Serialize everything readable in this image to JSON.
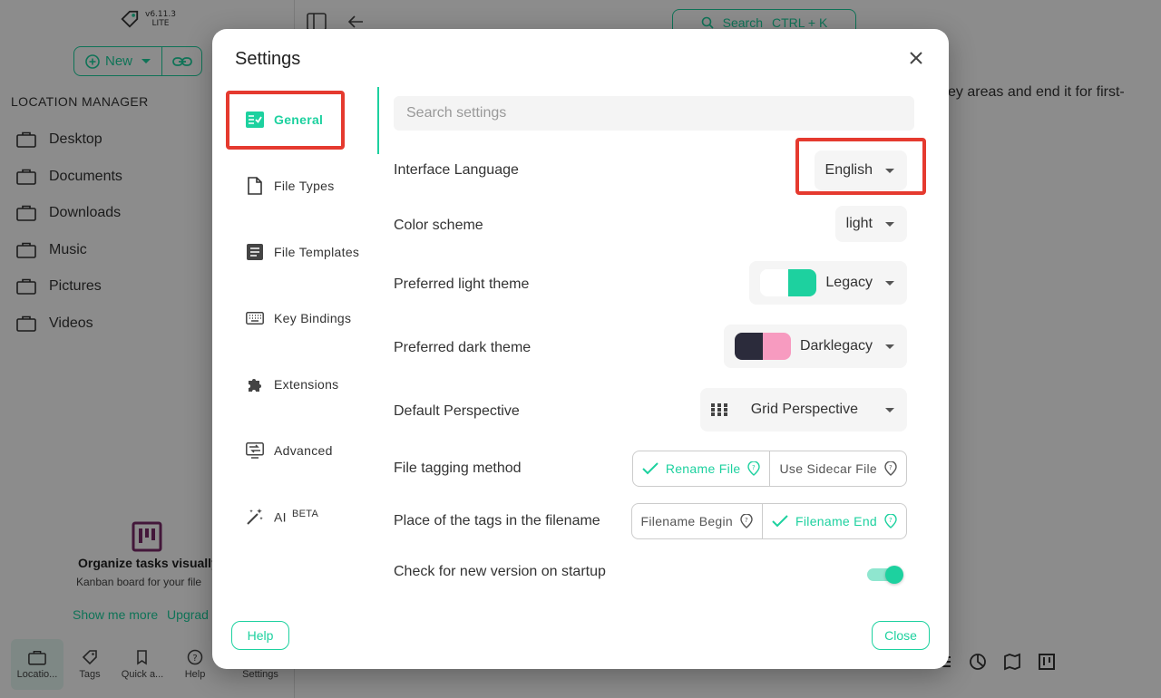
{
  "app": {
    "version": "v6.11.3",
    "edition": "LITE",
    "new_label": "New",
    "search_label": "Search",
    "search_shortcut": "CTRL + K",
    "location_manager_title": "LOCATION MANAGER",
    "locations": [
      "Desktop",
      "Documents",
      "Downloads",
      "Music",
      "Pictures",
      "Videos"
    ],
    "bg_text": "ey areas and end it for first-",
    "promo": {
      "title": "Organize tasks visually",
      "subtitle": "Kanban board for your file",
      "link_more": "Show me more",
      "link_upgrade": "Upgrad"
    },
    "bottom_nav": [
      "Locatio...",
      "Tags",
      "Quick a...",
      "Help",
      "Settings"
    ]
  },
  "dialog": {
    "title": "Settings",
    "tabs": [
      {
        "label": "General",
        "icon": "general-settings-icon"
      },
      {
        "label": "File Types",
        "icon": "file-icon"
      },
      {
        "label": "File Templates",
        "icon": "document-icon"
      },
      {
        "label": "Key Bindings",
        "icon": "keyboard-icon"
      },
      {
        "label": "Extensions",
        "icon": "puzzle-icon"
      },
      {
        "label": "Advanced",
        "icon": "advanced-icon"
      },
      {
        "label": "AI",
        "icon": "magic-wand-icon",
        "badge": "BETA"
      }
    ],
    "search_placeholder": "Search settings",
    "settings": {
      "interface_language": {
        "label": "Interface Language",
        "value": "English"
      },
      "color_scheme": {
        "label": "Color scheme",
        "value": "light"
      },
      "light_theme": {
        "label": "Preferred light theme",
        "value": "Legacy",
        "swatch": [
          "#ffffff",
          "#1dd19f"
        ]
      },
      "dark_theme": {
        "label": "Preferred dark theme",
        "value": "Darklegacy",
        "swatch": [
          "#2b2b3b",
          "#f79bc0"
        ]
      },
      "perspective": {
        "label": "Default Perspective",
        "value": "Grid Perspective"
      },
      "tagging_method": {
        "label": "File tagging method",
        "options": [
          "Rename File",
          "Use Sidecar File"
        ],
        "selected": "Rename File"
      },
      "tags_place": {
        "label": "Place of the tags in the filename",
        "options": [
          "Filename Begin",
          "Filename End"
        ],
        "selected": "Filename End"
      },
      "check_version": {
        "label": "Check for new version on startup",
        "enabled": true
      }
    },
    "help_label": "Help",
    "close_label": "Close"
  },
  "colors": {
    "accent": "#1dd19f",
    "highlight": "#e53a2f"
  }
}
